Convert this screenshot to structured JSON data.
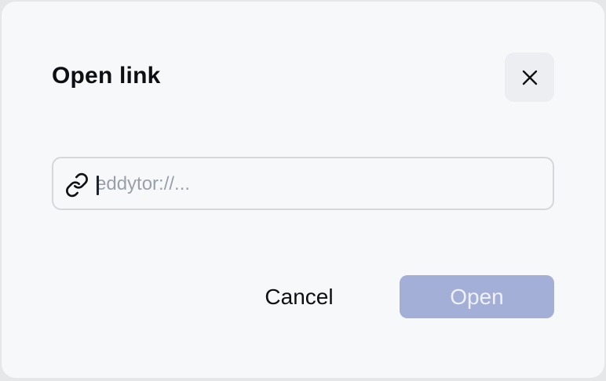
{
  "dialog": {
    "title": "Open link",
    "close_icon": "close-icon",
    "input": {
      "placeholder": "eddytor://...",
      "value": "",
      "icon": "link-icon"
    },
    "buttons": {
      "cancel_label": "Cancel",
      "open_label": "Open",
      "open_disabled": true
    }
  },
  "colors": {
    "background": "#f7f8fa",
    "primary_disabled": "#a3afd6",
    "border": "#d5d7db",
    "text": "#0e0f12",
    "placeholder": "#9aa0aa"
  }
}
